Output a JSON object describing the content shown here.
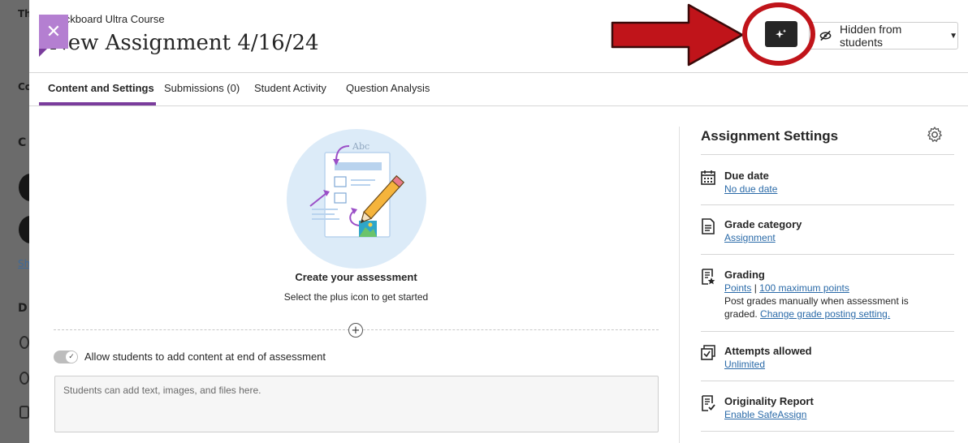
{
  "header": {
    "course_name": "Blackboard Ultra Course",
    "title": "New Assignment 4/16/24",
    "visibility_label": "Hidden from students"
  },
  "tabs": [
    {
      "label": "Content and Settings",
      "active": true
    },
    {
      "label": "Submissions (0)"
    },
    {
      "label": "Student Activity"
    },
    {
      "label": "Question Analysis"
    }
  ],
  "empty_state": {
    "title": "Create your assessment",
    "subtitle": "Select the plus icon to get started",
    "illustration_text": "Abc"
  },
  "toggle": {
    "label": "Allow students to add content at end of assessment",
    "on": true
  },
  "student_content_placeholder": "Students can add text, images, and files here.",
  "settings": {
    "title": "Assignment Settings",
    "due_date": {
      "label": "Due date",
      "value": "No due date"
    },
    "grade_category": {
      "label": "Grade category",
      "value": "Assignment"
    },
    "grading": {
      "label": "Grading",
      "schema": "Points",
      "separator": "|",
      "max_points": "100 maximum points",
      "posting_text": "Post grades manually when assessment is graded.",
      "posting_link": "Change grade posting setting."
    },
    "attempts": {
      "label": "Attempts allowed",
      "value": "Unlimited"
    },
    "originality": {
      "label": "Originality Report",
      "value": "Enable SafeAssign"
    }
  },
  "background_fragments": [
    "Th",
    "Co",
    "C",
    "Sh",
    "D"
  ],
  "colors": {
    "accent_purple": "#7a3c9c",
    "close_tab": "#b47fd1",
    "callout_red": "#c0141a",
    "link_blue": "#2a6aa8"
  },
  "icons": [
    "close-icon",
    "sparkle-icon",
    "eye-slash-icon",
    "chevron-down-icon",
    "gear-icon",
    "plus-circle-icon",
    "calendar-icon",
    "document-icon",
    "grading-icon",
    "attempts-icon",
    "originality-icon"
  ]
}
